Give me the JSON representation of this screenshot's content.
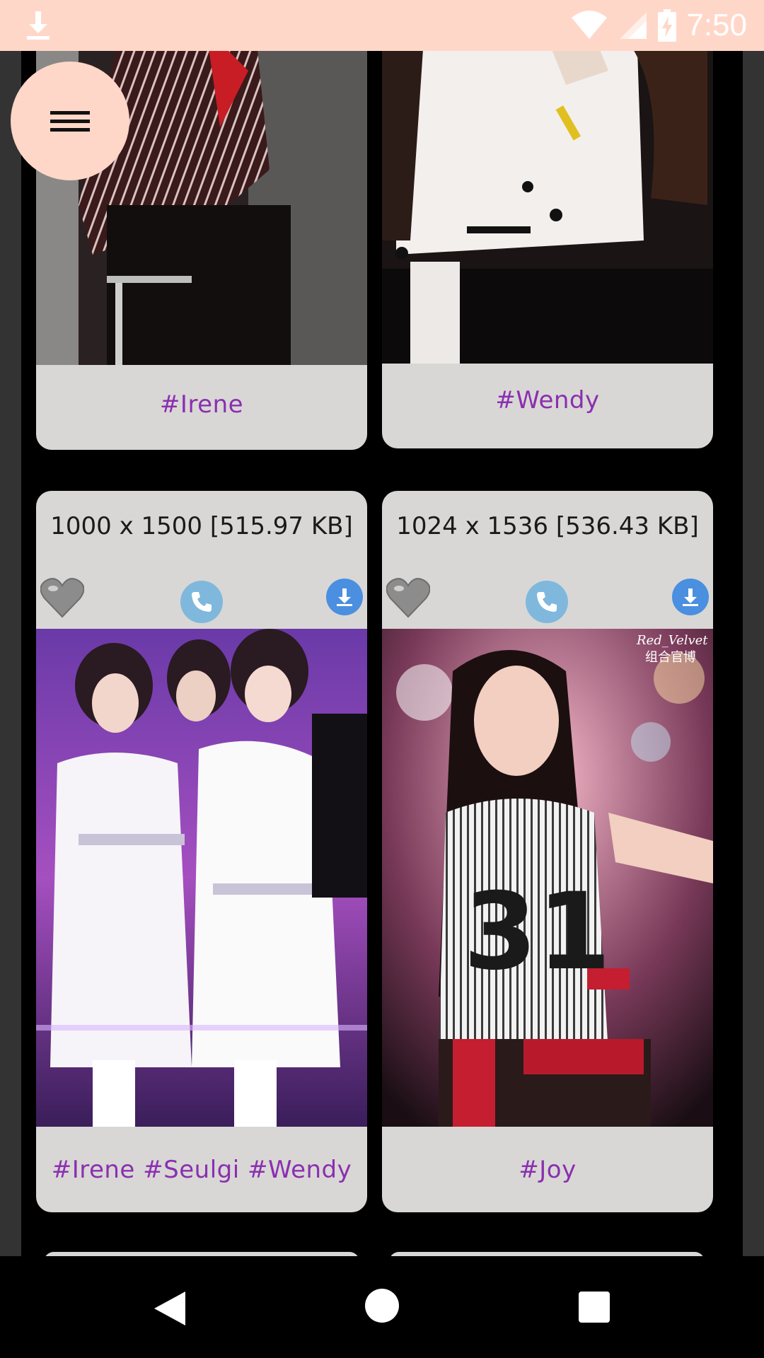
{
  "status_bar": {
    "time": "7:50",
    "icons": [
      "download-icon",
      "wifi-icon",
      "signal-icon",
      "battery-charging-icon"
    ],
    "background": "#ffd7c8"
  },
  "menu": {
    "icon": "hamburger-menu-icon"
  },
  "cards": [
    {
      "tags": "#Irene"
    },
    {
      "tags": "#Wendy"
    },
    {
      "dimensions": "1000 x 1500 [515.97 KB]",
      "tags": "#Irene #Seulgi #Wendy"
    },
    {
      "dimensions": "1024 x 1536 [536.43 KB]",
      "tags": "#Joy"
    }
  ],
  "colors": {
    "card_bg": "#d8d7d5",
    "tag_text": "#8b2fb0",
    "accent": "#ffd7c8"
  },
  "nav_bar": {
    "icons": [
      "back-icon",
      "home-icon",
      "recents-icon"
    ]
  }
}
